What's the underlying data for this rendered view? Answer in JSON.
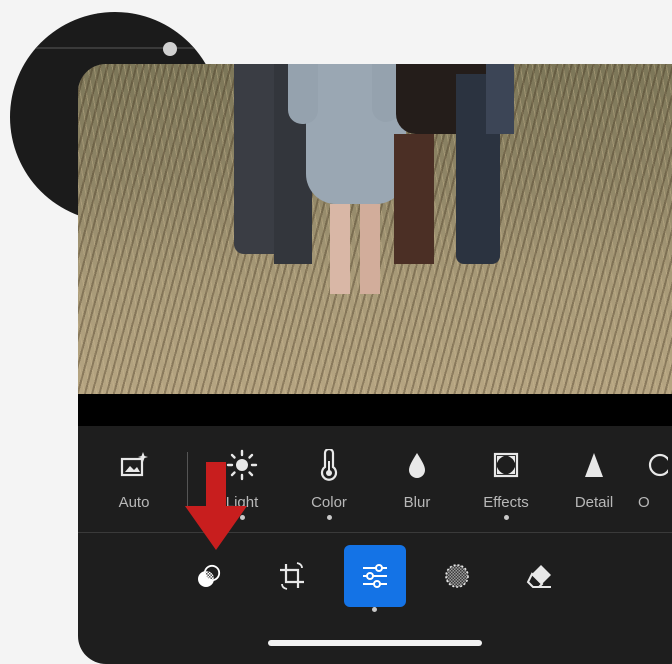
{
  "toolbar": {
    "tools": [
      {
        "label": "Auto",
        "icon": "auto-image-icon"
      },
      {
        "label": "Light",
        "icon": "sun-icon"
      },
      {
        "label": "Color",
        "icon": "thermometer-icon"
      },
      {
        "label": "Blur",
        "icon": "droplet-icon"
      },
      {
        "label": "Effects",
        "icon": "vignette-square-icon"
      },
      {
        "label": "Detail",
        "icon": "triangle-icon"
      },
      {
        "label": "O",
        "icon": "optics-icon"
      }
    ]
  },
  "modes": [
    {
      "name": "masking",
      "icon": "mask-circles-icon"
    },
    {
      "name": "crop",
      "icon": "crop-rotate-icon"
    },
    {
      "name": "edit",
      "icon": "sliders-icon",
      "active": true
    },
    {
      "name": "heal",
      "icon": "dotted-circle-icon"
    },
    {
      "name": "erase",
      "icon": "eraser-icon"
    }
  ],
  "zoom_callout": {
    "icon": "mask-circles-icon"
  },
  "colors": {
    "accent": "#1473e6",
    "arrow": "#c81e1e",
    "panel": "#1e1e1e"
  }
}
